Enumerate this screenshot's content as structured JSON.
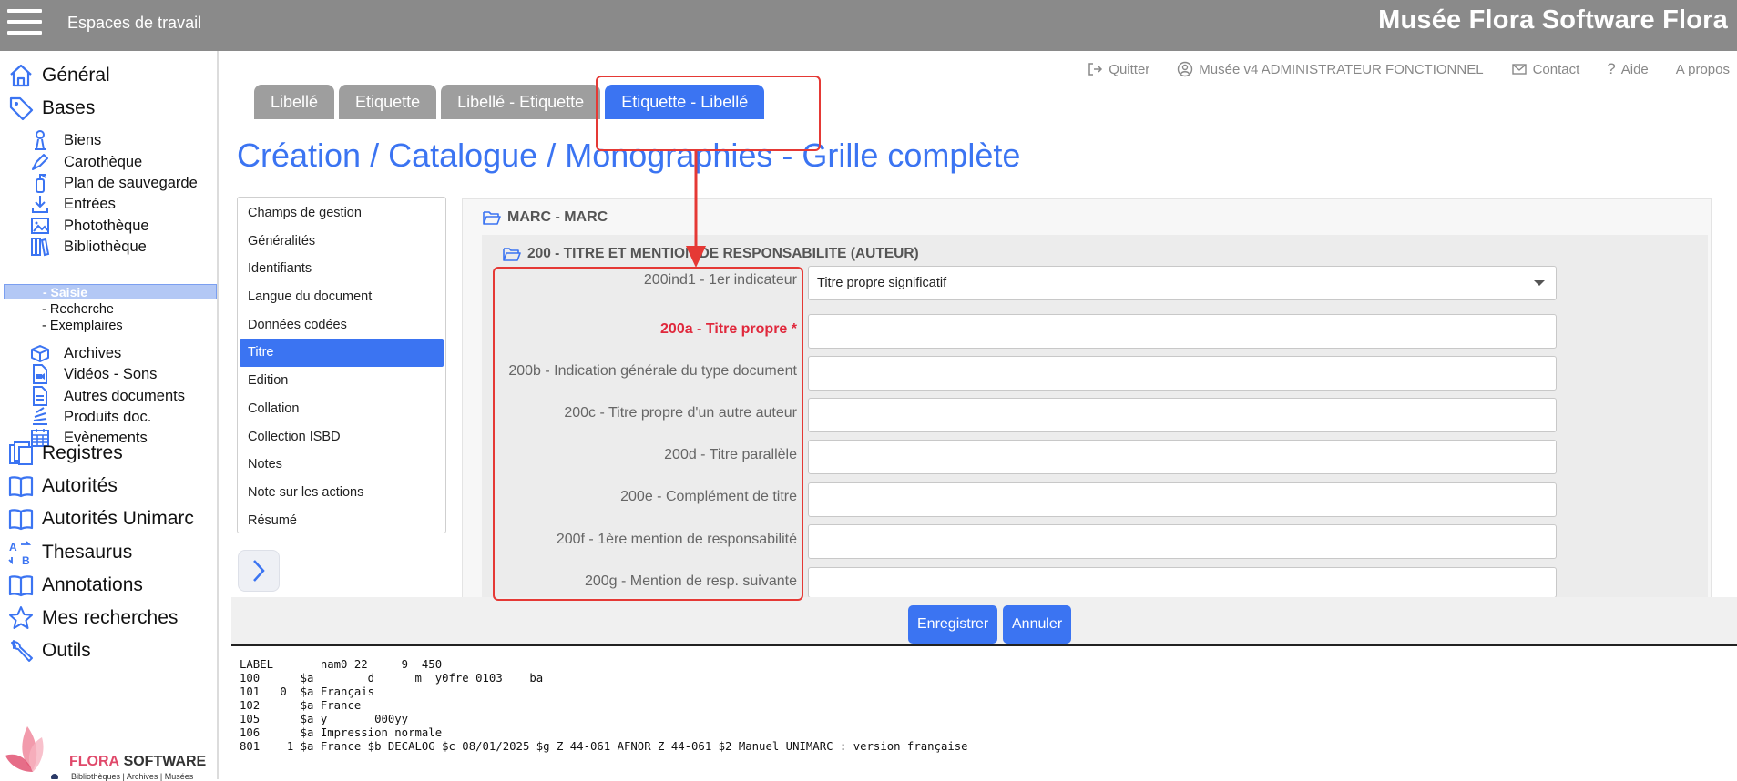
{
  "topbar": {
    "workspaces": "Espaces de travail",
    "app_title": "Musée Flora Software Flora"
  },
  "sidebar": {
    "main_top": [
      {
        "label": "Général",
        "icon": "home-icon"
      },
      {
        "label": "Bases",
        "icon": "tag-icon"
      }
    ],
    "bases_items": [
      {
        "label": "Biens",
        "icon": "sculpture-icon"
      },
      {
        "label": "Carothèque",
        "icon": "pen-icon"
      },
      {
        "label": "Plan de sauvegarde",
        "icon": "extinguisher-icon"
      },
      {
        "label": "Entrées",
        "icon": "download-icon"
      },
      {
        "label": "Photothèque",
        "icon": "image-icon"
      },
      {
        "label": "Bibliothèque",
        "icon": "books-icon"
      }
    ],
    "biblio_sub": [
      "- Saisie",
      "- Recherche",
      "- Exemplaires"
    ],
    "bases_items_2": [
      {
        "label": "Archives",
        "icon": "box-icon"
      },
      {
        "label": "Vidéos - Sons",
        "icon": "video-file-icon"
      },
      {
        "label": "Autres documents",
        "icon": "document-icon"
      },
      {
        "label": "Produits doc.",
        "icon": "stack-icon"
      },
      {
        "label": "Evènements",
        "icon": "calendar-icon"
      }
    ],
    "main_bottom": [
      {
        "label": "Registres",
        "icon": "registers-icon"
      },
      {
        "label": "Autorités",
        "icon": "book-open-icon"
      },
      {
        "label": "Autorités Unimarc",
        "icon": "book-open-icon"
      },
      {
        "label": "Thesaurus",
        "icon": "thesaurus-icon"
      },
      {
        "label": "Annotations",
        "icon": "book-open-icon"
      },
      {
        "label": "Mes recherches",
        "icon": "star-icon"
      },
      {
        "label": "Outils",
        "icon": "wrench-icon"
      }
    ],
    "logo": {
      "brand_a": "FLORA",
      "brand_b": "SOFTWARE",
      "tagline": "Bibliothèques | Archives | Musées"
    }
  },
  "topmenu": {
    "quit": "Quitter",
    "user": "Musée v4 ADMINISTRATEUR FONCTIONNEL",
    "contact": "Contact",
    "help": "Aide",
    "about": "A propos"
  },
  "tabs": [
    "Libellé",
    "Etiquette",
    "Libellé - Etiquette",
    "Etiquette - Libellé"
  ],
  "page_title": "Création / Catalogue / Monographies - Grille complète",
  "sections": [
    "Champs de gestion",
    "Généralités",
    "Identifiants",
    "Langue du document",
    "Données codées",
    "Titre",
    "Edition",
    "Collation",
    "Collection ISBD",
    "Notes",
    "Note sur les actions",
    "Résumé"
  ],
  "form": {
    "marc_header": "MARC - MARC",
    "zone_header": "200 - TITRE ET MENTION DE RESPONSABILITE (AUTEUR)",
    "fields": [
      {
        "label": "200ind1 - 1er indicateur",
        "value": "Titre propre significatif"
      },
      {
        "label": "200a - Titre propre *",
        "value": ""
      },
      {
        "label": "200b - Indication générale du type document",
        "value": ""
      },
      {
        "label": "200c - Titre propre d'un autre auteur",
        "value": ""
      },
      {
        "label": "200d - Titre parallèle",
        "value": ""
      },
      {
        "label": "200e - Complément de titre",
        "value": ""
      },
      {
        "label": "200f - 1ère mention de responsabilité",
        "value": ""
      },
      {
        "label": "200g - Mention de resp. suivante",
        "value": ""
      }
    ]
  },
  "buttons": {
    "save": "Enregistrer",
    "cancel": "Annuler"
  },
  "preview_lines": [
    "LABEL       nam0 22     9  450",
    "100      $a        d      m  y0fre 0103    ba",
    "101   0  $a Français",
    "102      $a France",
    "105      $a y       000yy",
    "106      $a Impression normale",
    "801    1 $a France $b DECALOG $c 08/01/2025 $g Z 44-061 AFNOR Z 44-061 $2 Manuel UNIMARC : version française"
  ],
  "colors": {
    "accent": "#3b74f2",
    "topbar": "#8a8a8a",
    "annotation": "#e53935",
    "required": "#e0283c"
  }
}
